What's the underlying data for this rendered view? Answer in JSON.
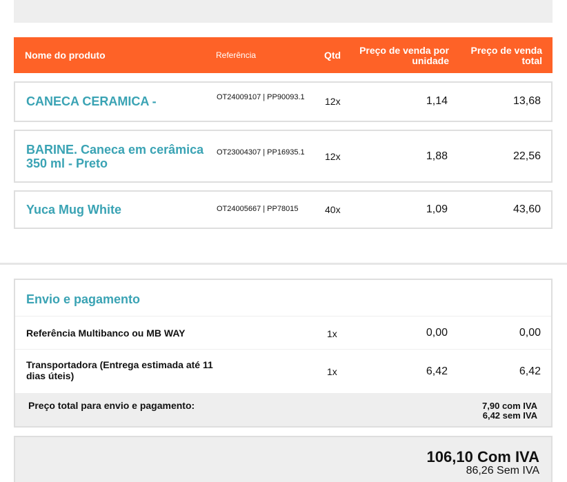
{
  "table_header": {
    "name": "Nome do produto",
    "reference": "Referência",
    "qty": "Qtd",
    "unit_price": "Preço de venda por unidade",
    "total_price": "Preço de venda total"
  },
  "products": [
    {
      "name": "CANECA CERAMICA -",
      "reference": "OT24009107 | PP90093.1",
      "qty": "12x",
      "unit_price": "1,14",
      "total": "13,68"
    },
    {
      "name": "BARINE. Caneca em cerâmica 350 ml - Preto",
      "reference": "OT23004307 | PP16935.1",
      "qty": "12x",
      "unit_price": "1,88",
      "total": "22,56"
    },
    {
      "name": "Yuca Mug White",
      "reference": "OT24005667 | PP78015",
      "qty": "40x",
      "unit_price": "1,09",
      "total": "43,60"
    }
  ],
  "shipping": {
    "title": "Envio e pagamento",
    "rows": [
      {
        "label": "Referência Multibanco ou MB WAY",
        "qty": "1x",
        "unit": "0,00",
        "total": "0,00"
      },
      {
        "label": "Transportadora (Entrega estimada até 11 dias úteis)",
        "qty": "1x",
        "unit": "6,42",
        "total": "6,42"
      }
    ],
    "footer_label": "Preço total para envio e pagamento:",
    "footer_with_vat": "7,90 com IVA",
    "footer_without_vat": "6,42 sem IVA"
  },
  "grand_total": {
    "with_vat": "106,10 Com IVA",
    "without_vat": "86,26 Sem IVA"
  },
  "colors": {
    "header_bg": "#fe6227",
    "product_name": "#3aa3b4",
    "panel_grey": "#eeeeee"
  }
}
